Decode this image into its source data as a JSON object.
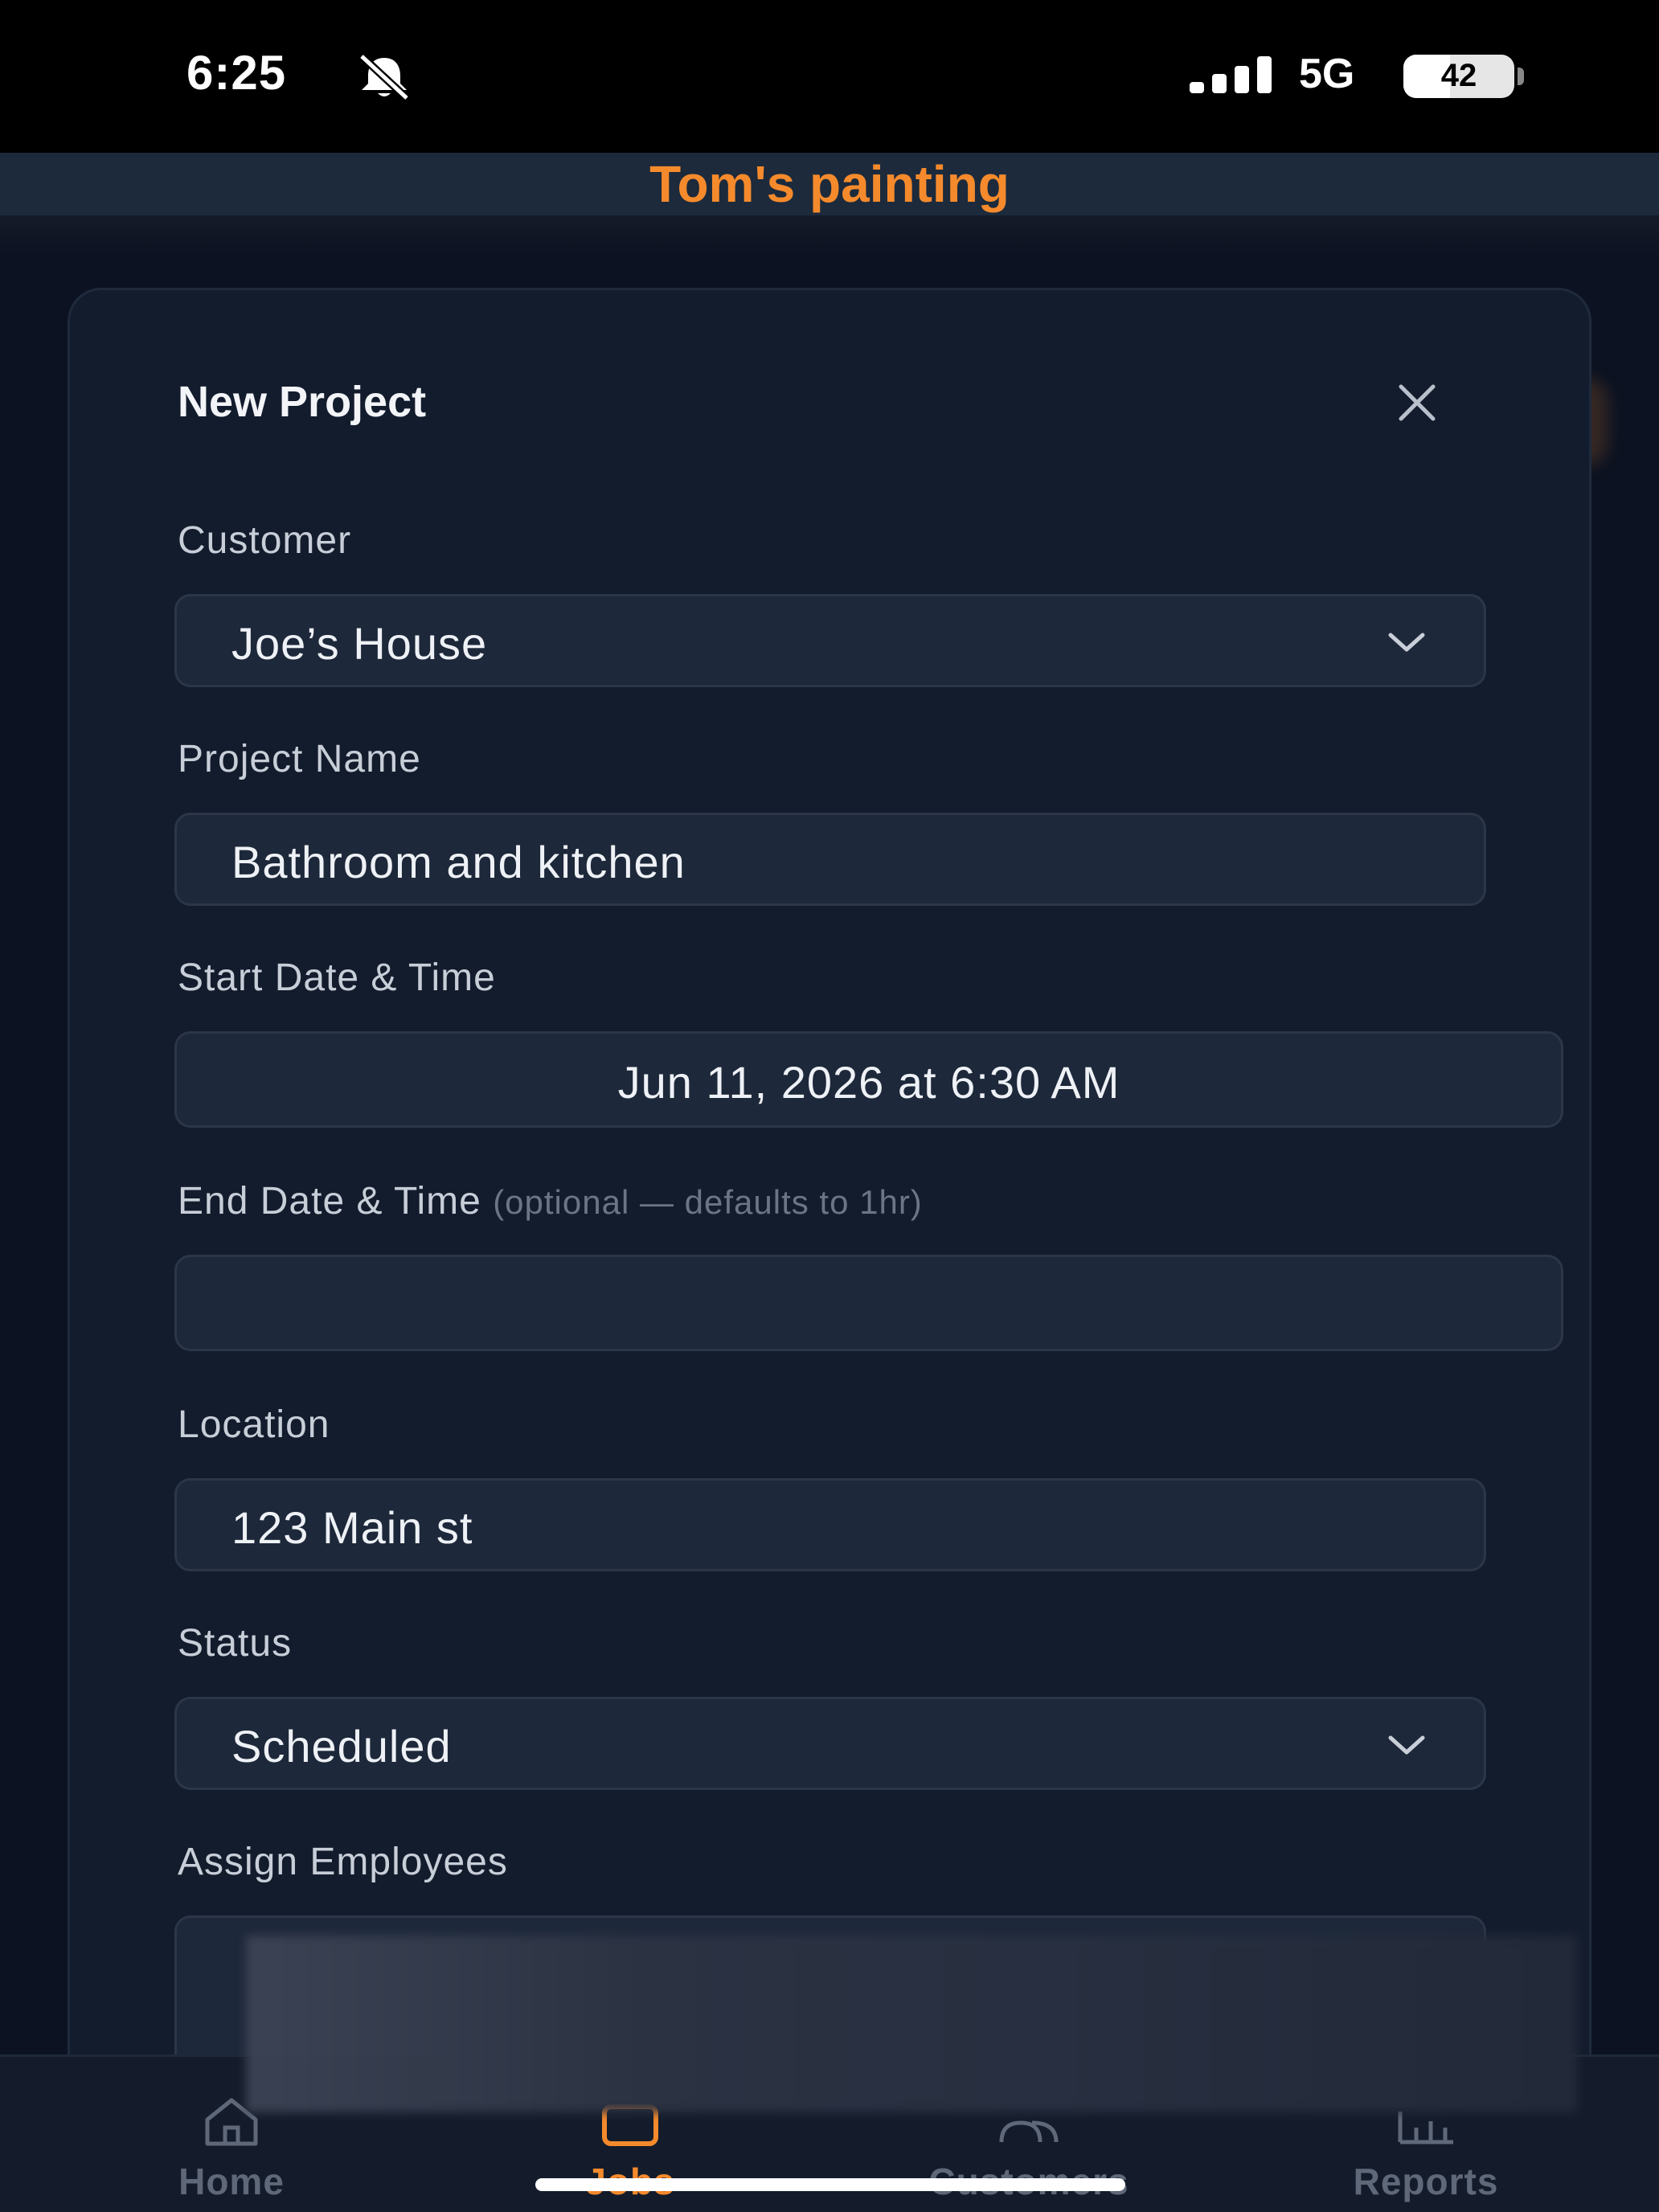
{
  "status_bar": {
    "time": "6:25",
    "network": "5G",
    "battery": {
      "label": "42",
      "percent": 42
    },
    "icons": [
      "bell-slash-icon",
      "cellular-signal-icon",
      "battery-icon"
    ]
  },
  "app": {
    "title": "Tom's painting",
    "accent_color": "#f58a2c"
  },
  "modal": {
    "title": "New Project",
    "close_icon": "close-icon",
    "fields": {
      "customer": {
        "label": "Customer",
        "value": "Joe’s House"
      },
      "project_name": {
        "label": "Project Name",
        "value": "Bathroom and kitchen"
      },
      "start": {
        "label": "Start Date & Time",
        "value": "Jun 11, 2026 at 6:30 AM"
      },
      "end": {
        "label": "End Date & Time",
        "hint": "(optional — defaults to 1hr)",
        "value": ""
      },
      "location": {
        "label": "Location",
        "value": "123 Main st"
      },
      "status": {
        "label": "Status",
        "value": "Scheduled"
      },
      "employees": {
        "label": "Assign Employees"
      }
    }
  },
  "bottom_nav": {
    "items": [
      {
        "label": "Home",
        "icon": "home-icon",
        "active": false
      },
      {
        "label": "Jobs",
        "icon": "briefcase-icon",
        "active": true
      },
      {
        "label": "Customers",
        "icon": "users-icon",
        "active": false
      },
      {
        "label": "Reports",
        "icon": "bar-chart-icon",
        "active": false
      }
    ]
  }
}
